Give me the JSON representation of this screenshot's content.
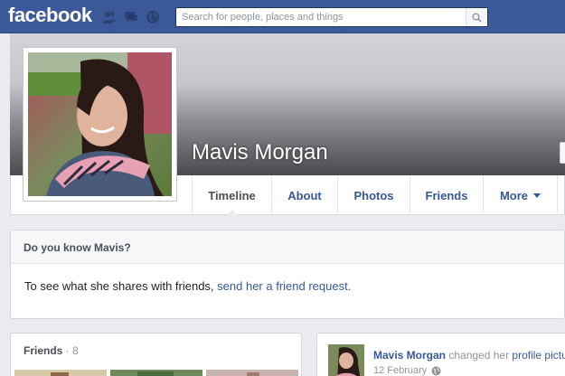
{
  "topbar": {
    "logo_text": "facebook",
    "search_placeholder": "Search for people, places and things",
    "jewels": [
      "friends-requests-icon",
      "messages-icon",
      "notifications-globe-icon"
    ],
    "search_icon": "magnifier-icon"
  },
  "colors": {
    "brand_blue": "#3b5998",
    "link_blue": "#365899",
    "page_bg": "#e9ebee"
  },
  "profile": {
    "name": "Mavis Morgan"
  },
  "tabs": [
    {
      "label": "Timeline",
      "active": true
    },
    {
      "label": "About"
    },
    {
      "label": "Photos"
    },
    {
      "label": "Friends"
    },
    {
      "label": "More"
    }
  ],
  "know_box": {
    "title": "Do you know Mavis?",
    "text": "To see what she shares with friends, ",
    "link": "send her a friend request."
  },
  "friends_box": {
    "title": "Friends",
    "separator": " · ",
    "count": "8"
  },
  "story": {
    "actor": "Mavis Morgan",
    "action": " changed her ",
    "link": "profile pictu",
    "date": "12 February",
    "audience_icon": "public-globe-icon"
  }
}
